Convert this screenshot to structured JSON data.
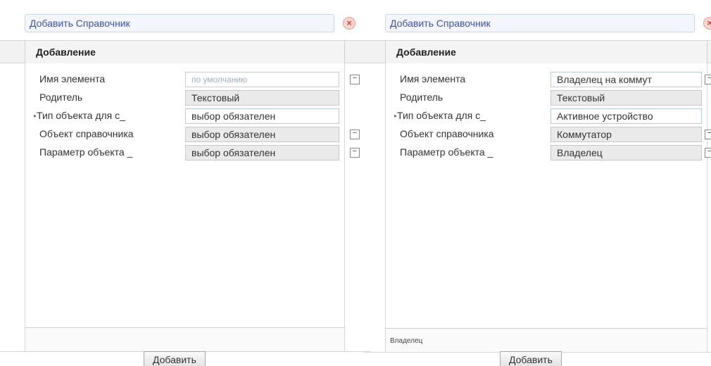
{
  "panels": [
    {
      "title": "Добавить Справочник",
      "close_icon": "×",
      "header": "Добавление",
      "rows": [
        {
          "label": "Имя элемента",
          "value": "по умолчанию",
          "style": "placeholder",
          "marker": false,
          "button": true
        },
        {
          "label": "Родитель",
          "value": "Текстовый",
          "style": "grey",
          "marker": false,
          "button": false
        },
        {
          "label": "Тип объекта для с_",
          "value": "выбор обязателен",
          "style": "white",
          "marker": true,
          "button": false
        },
        {
          "label": "Объект справочника",
          "value": "выбор обязателен",
          "style": "grey",
          "marker": false,
          "button": true
        },
        {
          "label": "Параметр объекта _",
          "value": "выбор обязателен",
          "style": "grey",
          "marker": false,
          "button": true
        }
      ],
      "status": "",
      "add_label": "Добавить"
    },
    {
      "title": "Добавить Справочник",
      "close_icon": "×",
      "header": "Добавление",
      "rows": [
        {
          "label": "Имя элемента",
          "value": "Владелец на коммут",
          "style": "white",
          "marker": false,
          "button": true
        },
        {
          "label": "Родитель",
          "value": "Текстовый",
          "style": "grey",
          "marker": false,
          "button": false
        },
        {
          "label": "Тип объекта для с_",
          "value": "Активное устройство",
          "style": "white",
          "marker": true,
          "button": false
        },
        {
          "label": "Объект справочника",
          "value": "Коммутатор",
          "style": "grey",
          "marker": false,
          "button": true
        },
        {
          "label": "Параметр объекта _",
          "value": "Владелец",
          "style": "grey",
          "marker": false,
          "button": true
        }
      ],
      "status": "Владелец",
      "add_label": "Добавить"
    }
  ],
  "icons": {
    "marker": "▸",
    "minus": "−"
  }
}
